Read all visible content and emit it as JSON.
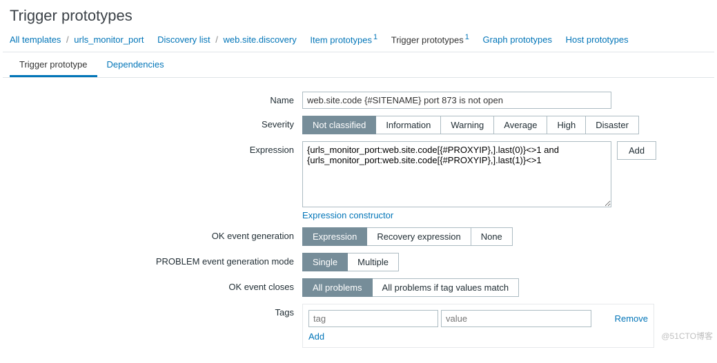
{
  "page_title": "Trigger prototypes",
  "breadcrumb": {
    "templates": "All templates",
    "template": "urls_monitor_port",
    "discovery_list": "Discovery list",
    "discovery_rule": "web.site.discovery",
    "item_proto": "Item prototypes",
    "item_proto_count": "1",
    "trigger_proto": "Trigger prototypes",
    "trigger_proto_count": "1",
    "graph_proto": "Graph prototypes",
    "host_proto": "Host prototypes",
    "sep": "/"
  },
  "tabs": {
    "prototype": "Trigger prototype",
    "dependencies": "Dependencies"
  },
  "form": {
    "name_label": "Name",
    "name_value": "web.site.code {#SITENAME} port 873 is not open",
    "severity_label": "Severity",
    "severity_options": [
      "Not classified",
      "Information",
      "Warning",
      "Average",
      "High",
      "Disaster"
    ],
    "expression_label": "Expression",
    "expression_value": "{urls_monitor_port:web.site.code[{#PROXYIP},].last(0)}<>1 and\n{urls_monitor_port:web.site.code[{#PROXYIP},].last(1)}<>1",
    "add_btn": "Add",
    "expr_constructor": "Expression constructor",
    "ok_event_gen_label": "OK event generation",
    "ok_event_gen_options": [
      "Expression",
      "Recovery expression",
      "None"
    ],
    "problem_mode_label": "PROBLEM event generation mode",
    "problem_mode_options": [
      "Single",
      "Multiple"
    ],
    "ok_event_closes_label": "OK event closes",
    "ok_event_closes_options": [
      "All problems",
      "All problems if tag values match"
    ],
    "tags_label": "Tags",
    "tag_placeholder": "tag",
    "value_placeholder": "value",
    "remove": "Remove",
    "add_link": "Add"
  },
  "watermark": "@51CTO博客"
}
